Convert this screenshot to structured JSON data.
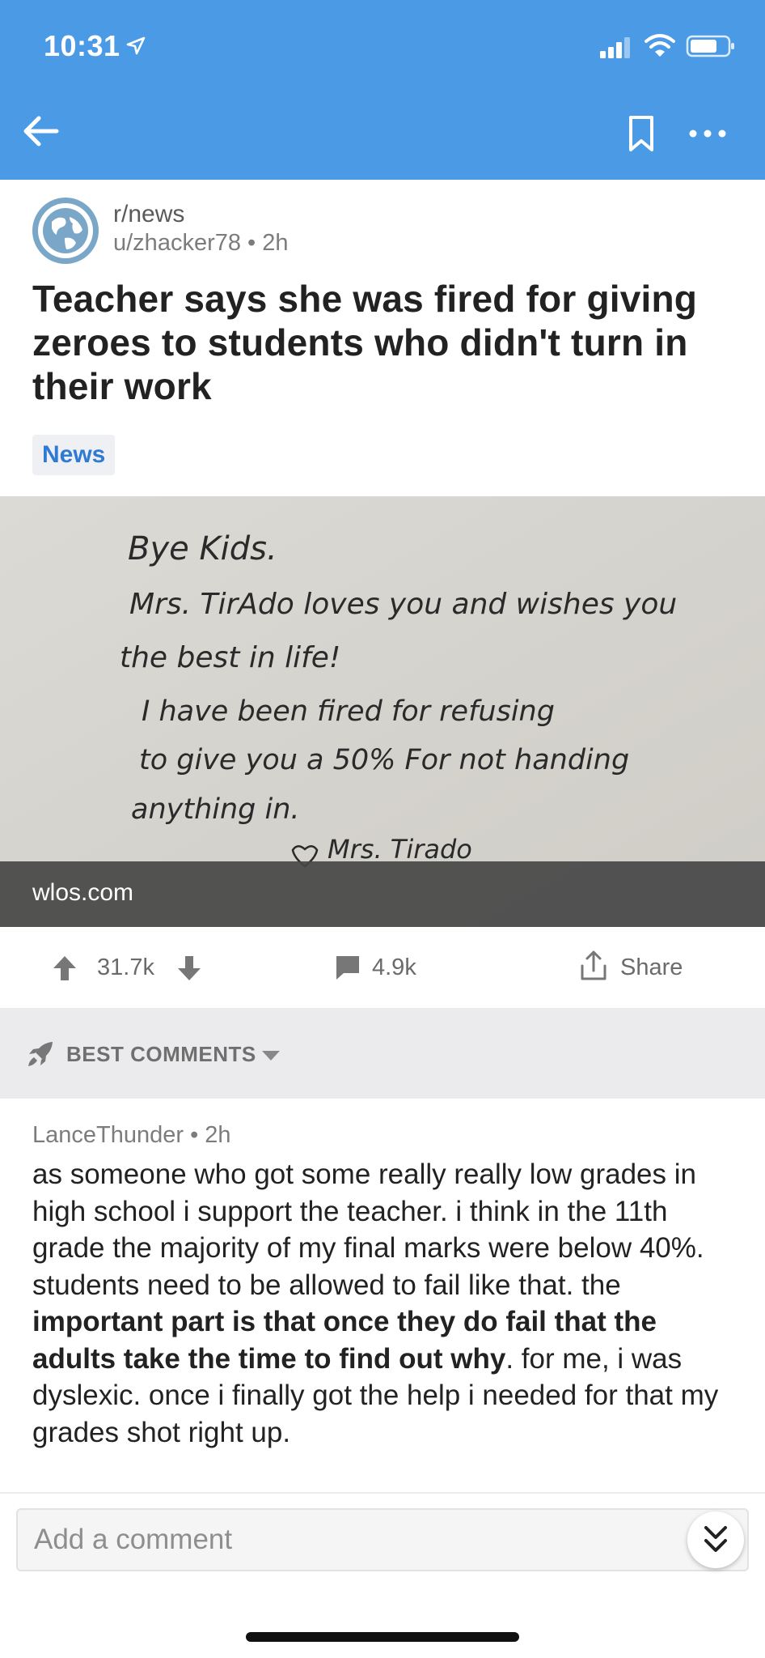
{
  "status_bar": {
    "time": "10:31"
  },
  "post": {
    "subreddit": "r/news",
    "meta": "u/zhacker78 • 2h",
    "title": "Teacher says she was fired for giving zeroes to students who didn't turn in their work",
    "flair": "News",
    "domain": "wlos.com"
  },
  "image_text": {
    "line1": "Bye Kids.",
    "line2": "Mrs. TirAdo loves you and wishes you",
    "line3": "the best in life!",
    "line4": "I have been fired for refusing",
    "line5": "to give you a 50% For not handing",
    "line6": "anything in.",
    "signature": "Mrs. Tirado"
  },
  "actions": {
    "score": "31.7k",
    "comments": "4.9k",
    "share": "Share"
  },
  "sort": {
    "label": "BEST COMMENTS"
  },
  "comment": {
    "author_meta": "LanceThunder • 2h",
    "body_1": "as someone who got some really really low grades in high school i support the teacher. i think in the 11th grade the majority of my final marks were below 40%.  students need to be allowed to fail like that. the ",
    "body_bold": "important part is that once they do fail that the adults take the time to find out why",
    "body_2": ". for me, i was dyslexic. once i finally got the help i needed for that my grades shot right up."
  },
  "reply": {
    "placeholder": "Add a comment"
  },
  "colors": {
    "app_bar": "#4a9ae6",
    "flair_text": "#2f7bd4",
    "sort_bar": "#ebebed"
  }
}
